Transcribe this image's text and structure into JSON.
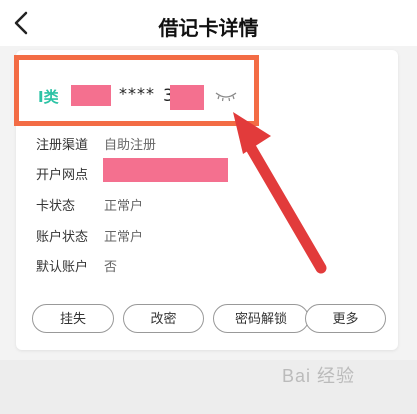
{
  "header": {
    "title": "借记卡详情"
  },
  "card": {
    "type_label": "I类",
    "masked_dots": "****",
    "last_digit_visible": "3"
  },
  "details": [
    {
      "label": "注册渠道",
      "value": "自助注册"
    },
    {
      "label": "开户网点",
      "value": ""
    },
    {
      "label": "卡状态",
      "value": "正常户"
    },
    {
      "label": "账户状态",
      "value": "正常户"
    },
    {
      "label": "默认账户",
      "value": "否"
    }
  ],
  "actions": [
    {
      "label": "挂失"
    },
    {
      "label": "改密"
    },
    {
      "label": "密码解锁"
    },
    {
      "label": "更多"
    }
  ],
  "watermark": {
    "text": "Bai 经验"
  },
  "colors": {
    "accent": "#2cc3a5",
    "highlight": "#f36c45",
    "redact": "#f4708f",
    "arrow": "#e23b3b"
  }
}
